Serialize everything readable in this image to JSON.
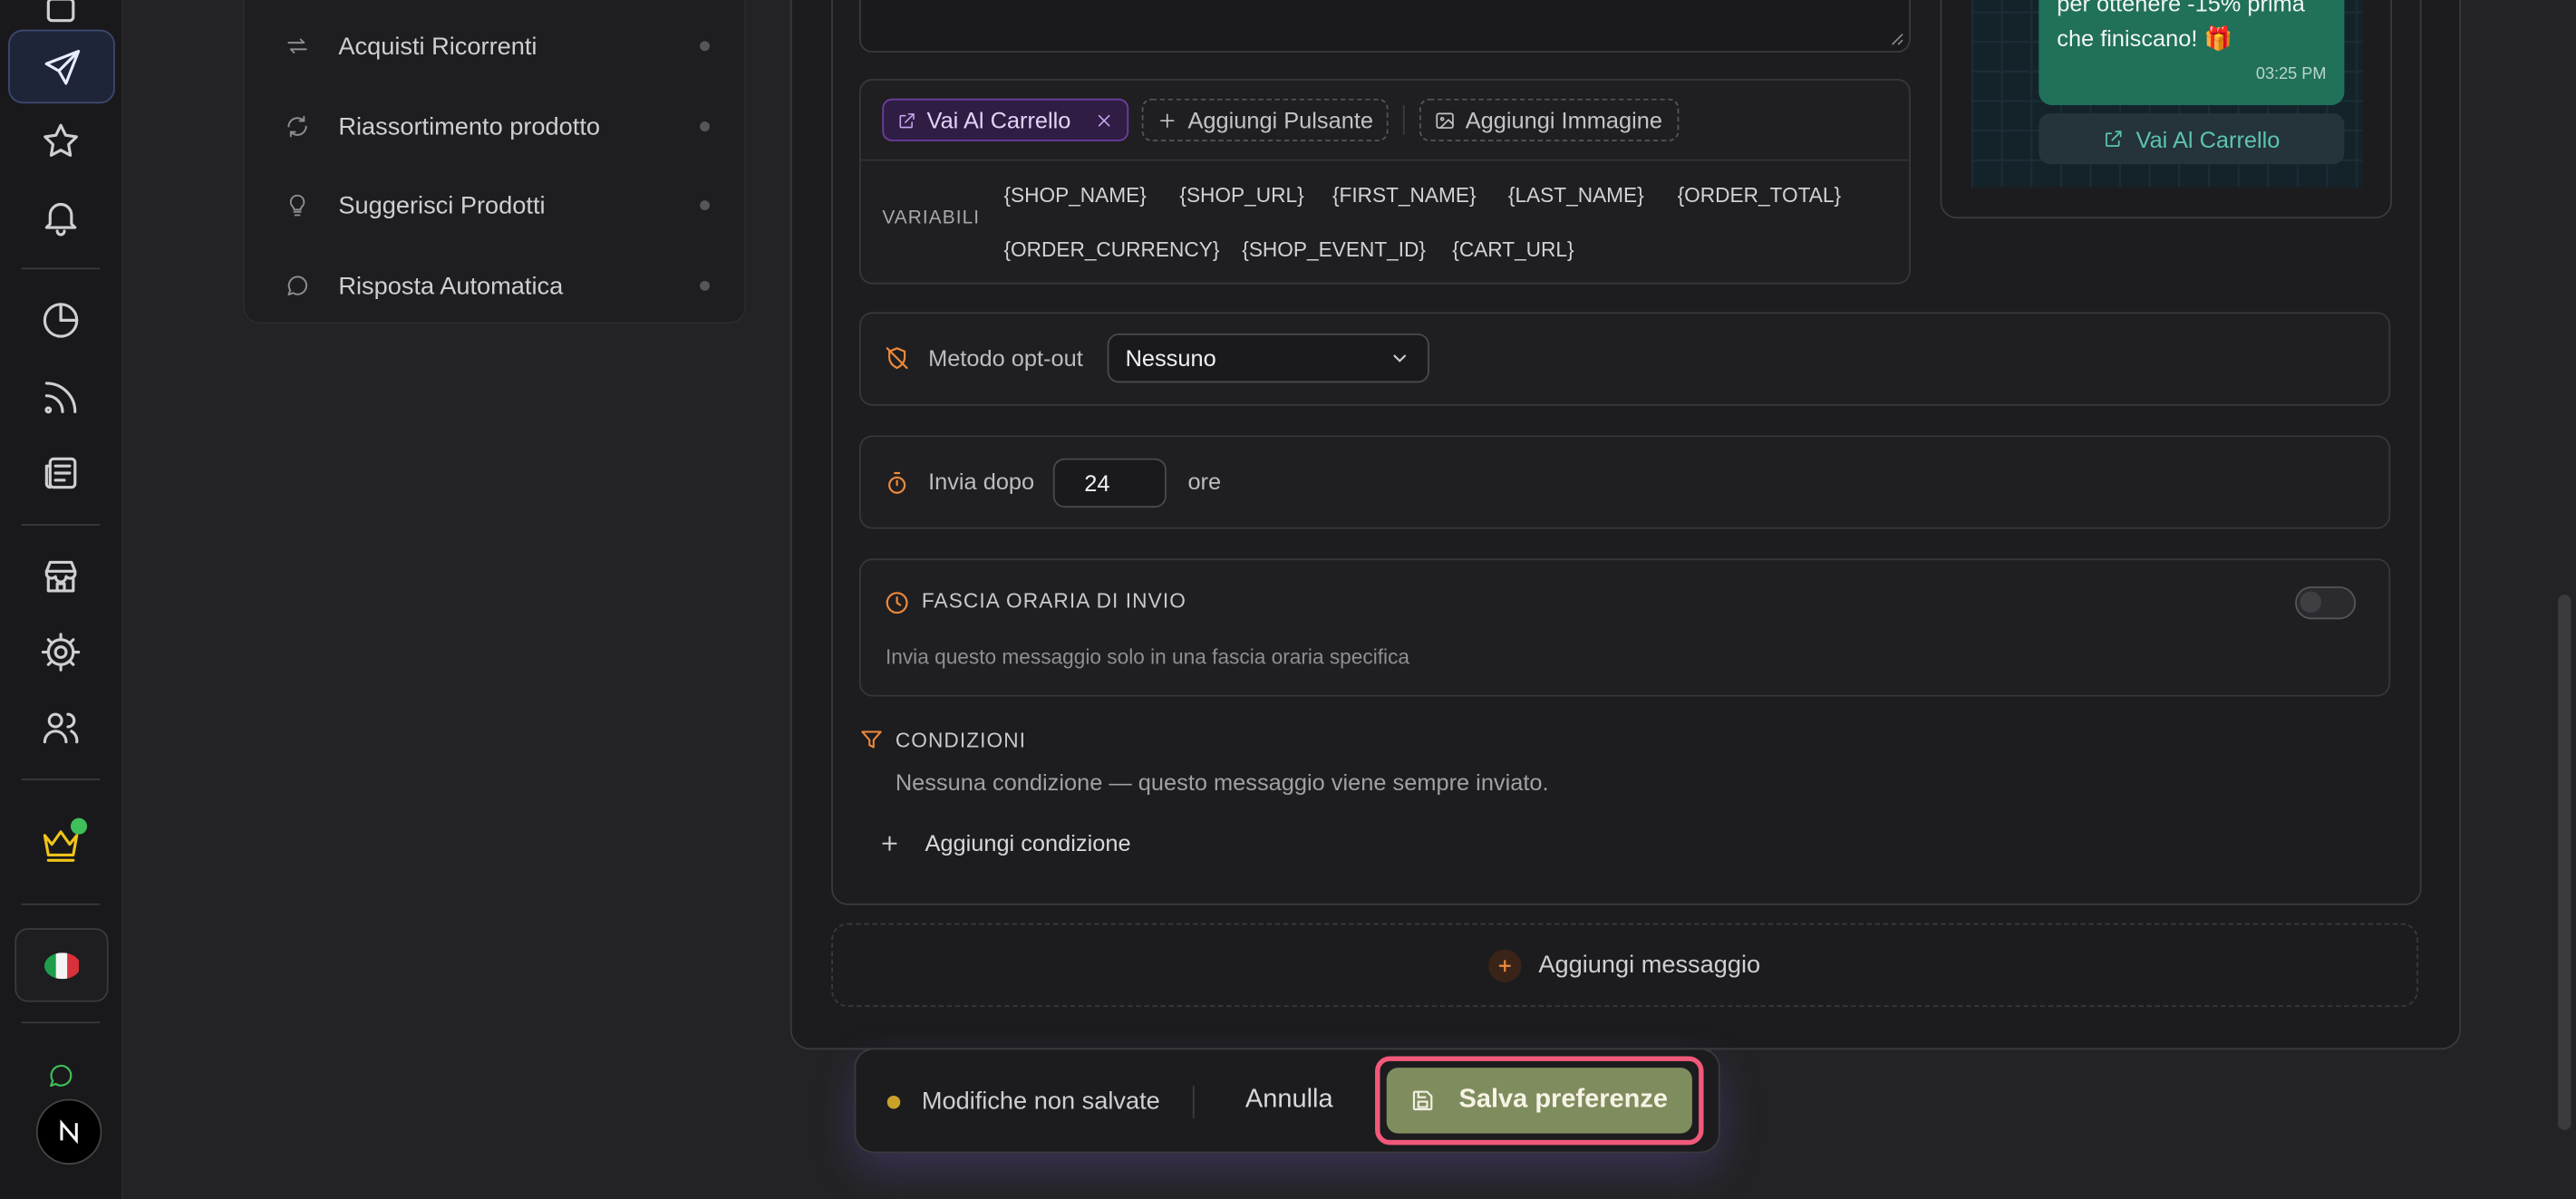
{
  "sidebar": {
    "nav_items": [
      {
        "label": "Acquisti Ricorrenti",
        "icon": "repeat-icon"
      },
      {
        "label": "Riassortimento prodotto",
        "icon": "refresh-icon"
      },
      {
        "label": "Suggerisci Prodotti",
        "icon": "lightbulb-icon"
      },
      {
        "label": "Risposta Automatica",
        "icon": "chat-bubble-icon"
      }
    ]
  },
  "editor": {
    "buttons": {
      "cart_button_label": "Vai Al Carrello",
      "add_button_label": "Aggiungi Pulsante",
      "add_image_label": "Aggiungi Immagine"
    },
    "variables_label": "VARIABILI",
    "variables": [
      "{SHOP_NAME}",
      "{SHOP_URL}",
      "{FIRST_NAME}",
      "{LAST_NAME}",
      "{ORDER_TOTAL}",
      "{ORDER_CURRENCY}",
      "{SHOP_EVENT_ID}",
      "{CART_URL}"
    ],
    "optout": {
      "label": "Metodo opt-out",
      "selected": "Nessuno"
    },
    "send_after": {
      "label": "Invia dopo",
      "value": "24",
      "unit": "ore"
    },
    "time_window": {
      "title": "FASCIA ORARIA DI INVIO",
      "description": "Invia questo messaggio solo in una fascia oraria specifica",
      "enabled": false
    },
    "conditions": {
      "title": "CONDIZIONI",
      "empty_text": "Nessuna condizione — questo messaggio viene sempre inviato.",
      "add_label": "Aggiungi condizione"
    },
    "add_message_label": "Aggiungi messaggio"
  },
  "preview": {
    "message_line1": "per ottenere -15% prima",
    "message_line2": "che finiscano! 🎁",
    "time": "03:25 PM",
    "button_label": "Vai Al Carrello"
  },
  "save_bar": {
    "status": "Modifiche non salvate",
    "cancel_label": "Annulla",
    "save_label": "Salva preferenze"
  },
  "colors": {
    "accent_orange": "#f08a3c",
    "save_button": "#7f8d5e",
    "highlight_border": "#f2587a",
    "whatsapp_bubble": "#21705a",
    "cart_pill_bg": "#2f1d44"
  }
}
